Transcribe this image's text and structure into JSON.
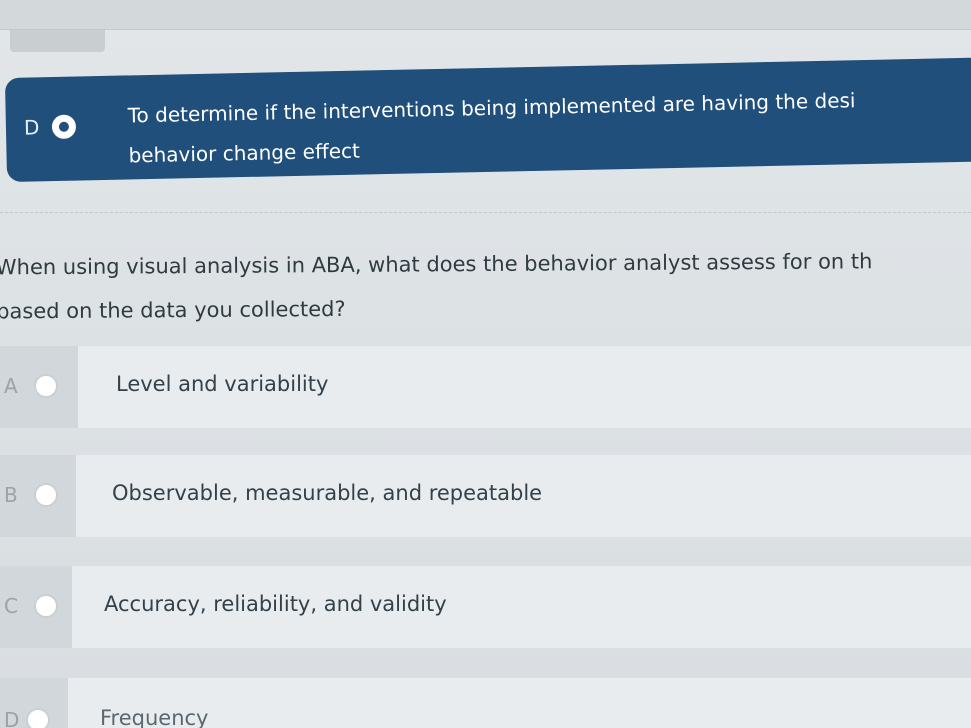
{
  "previous_question": {
    "selected_option": {
      "letter": "D",
      "line1": "To determine if the interventions being implemented are having the desi",
      "line2": "behavior change effect"
    }
  },
  "question": {
    "line1": "When using visual analysis in ABA, what does the behavior analyst assess for on th",
    "line2": "based on the data you collected?"
  },
  "options": [
    {
      "letter": "A",
      "label": "Level and variability"
    },
    {
      "letter": "B",
      "label": "Observable, measurable, and repeatable"
    },
    {
      "letter": "C",
      "label": "Accuracy, reliability, and validity"
    },
    {
      "letter": "D",
      "label": "Frequency"
    }
  ],
  "colors": {
    "selected_bg": "#1f4f7a",
    "option_bg": "#e8ecee",
    "text": "#34414a"
  }
}
